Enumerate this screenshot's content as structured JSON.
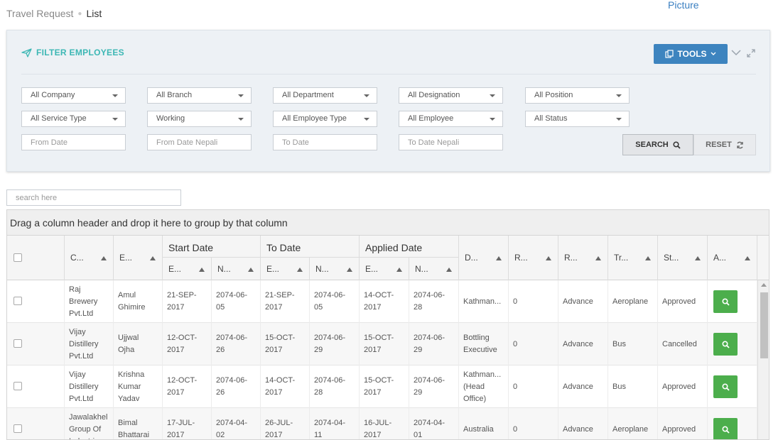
{
  "breadcrumb": {
    "parent": "Travel Request",
    "current": "List"
  },
  "picture_link": "Picture",
  "filter": {
    "title": "FILTER EMPLOYEES",
    "tools_label": "TOOLS",
    "row1": [
      "All Company",
      "All Branch",
      "All Department",
      "All Designation",
      "All Position"
    ],
    "row2": [
      "All Service Type",
      "Working",
      "All Employee Type",
      "All Employee",
      "All Status"
    ],
    "dates": [
      "From Date",
      "From Date Nepali",
      "To Date",
      "To Date Nepali"
    ],
    "search_label": "SEARCH",
    "reset_label": "RESET"
  },
  "grid": {
    "search_placeholder": "search here",
    "group_hint": "Drag a column header and drop it here to group by that column",
    "groups": [
      "Start Date",
      "To Date",
      "Applied Date"
    ],
    "headers": [
      "C...",
      "E...",
      "E...",
      "N...",
      "E...",
      "N...",
      "E...",
      "N...",
      "D...",
      "R...",
      "R...",
      "Tr...",
      "St...",
      "A..."
    ],
    "rows": [
      {
        "company": [
          "Raj",
          "Brewery",
          "Pvt.Ltd"
        ],
        "employee": [
          "Amul",
          "Ghimire"
        ],
        "start_en": [
          "21-SEP-",
          "2017"
        ],
        "start_np": [
          "2074-06-",
          "05"
        ],
        "to_en": [
          "21-SEP-",
          "2017"
        ],
        "to_np": [
          "2074-06-",
          "05"
        ],
        "applied_en": [
          "14-OCT-",
          "2017"
        ],
        "applied_np": [
          "2074-06-",
          "28"
        ],
        "destination": [
          "Kathman..."
        ],
        "r1": "0",
        "r2": "Advance",
        "travel": "Aeroplane",
        "status": "Approved"
      },
      {
        "company": [
          "Vijay",
          "Distillery",
          "Pvt.Ltd"
        ],
        "employee": [
          "Ujjwal",
          "Ojha"
        ],
        "start_en": [
          "12-OCT-",
          "2017"
        ],
        "start_np": [
          "2074-06-",
          "26"
        ],
        "to_en": [
          "15-OCT-",
          "2017"
        ],
        "to_np": [
          "2074-06-",
          "29"
        ],
        "applied_en": [
          "15-OCT-",
          "2017"
        ],
        "applied_np": [
          "2074-06-",
          "29"
        ],
        "destination": [
          "Bottling",
          "Executive"
        ],
        "r1": "0",
        "r2": "Advance",
        "travel": "Bus",
        "status": "Cancelled"
      },
      {
        "company": [
          "Vijay",
          "Distillery",
          "Pvt.Ltd"
        ],
        "employee": [
          "Krishna",
          "Kumar",
          "Yadav"
        ],
        "start_en": [
          "12-OCT-",
          "2017"
        ],
        "start_np": [
          "2074-06-",
          "26"
        ],
        "to_en": [
          "14-OCT-",
          "2017"
        ],
        "to_np": [
          "2074-06-",
          "28"
        ],
        "applied_en": [
          "15-OCT-",
          "2017"
        ],
        "applied_np": [
          "2074-06-",
          "29"
        ],
        "destination": [
          "Kathman...",
          "(Head",
          "Office)"
        ],
        "r1": "0",
        "r2": "Advance",
        "travel": "Bus",
        "status": "Approved"
      },
      {
        "company": [
          "Jawalakhel",
          "Group Of",
          "Industries"
        ],
        "employee": [
          "Bimal",
          "Bhattarai"
        ],
        "start_en": [
          "17-JUL-",
          "2017"
        ],
        "start_np": [
          "2074-04-",
          "02"
        ],
        "to_en": [
          "26-JUL-",
          "2017"
        ],
        "to_np": [
          "2074-04-",
          "11"
        ],
        "applied_en": [
          "16-JUL-",
          "2017"
        ],
        "applied_np": [
          "2074-04-",
          "01"
        ],
        "destination": [
          "Australia"
        ],
        "r1": "0",
        "r2": "Advance",
        "travel": "Aeroplane",
        "status": "Approved"
      }
    ]
  },
  "colors": {
    "accent": "#3cb7b4",
    "tools": "#3d84bf",
    "action": "#4cae4c"
  },
  "icons": [
    "send-icon",
    "copy-icon",
    "chevron-down-icon",
    "expand-icon",
    "search-icon",
    "refresh-icon"
  ]
}
